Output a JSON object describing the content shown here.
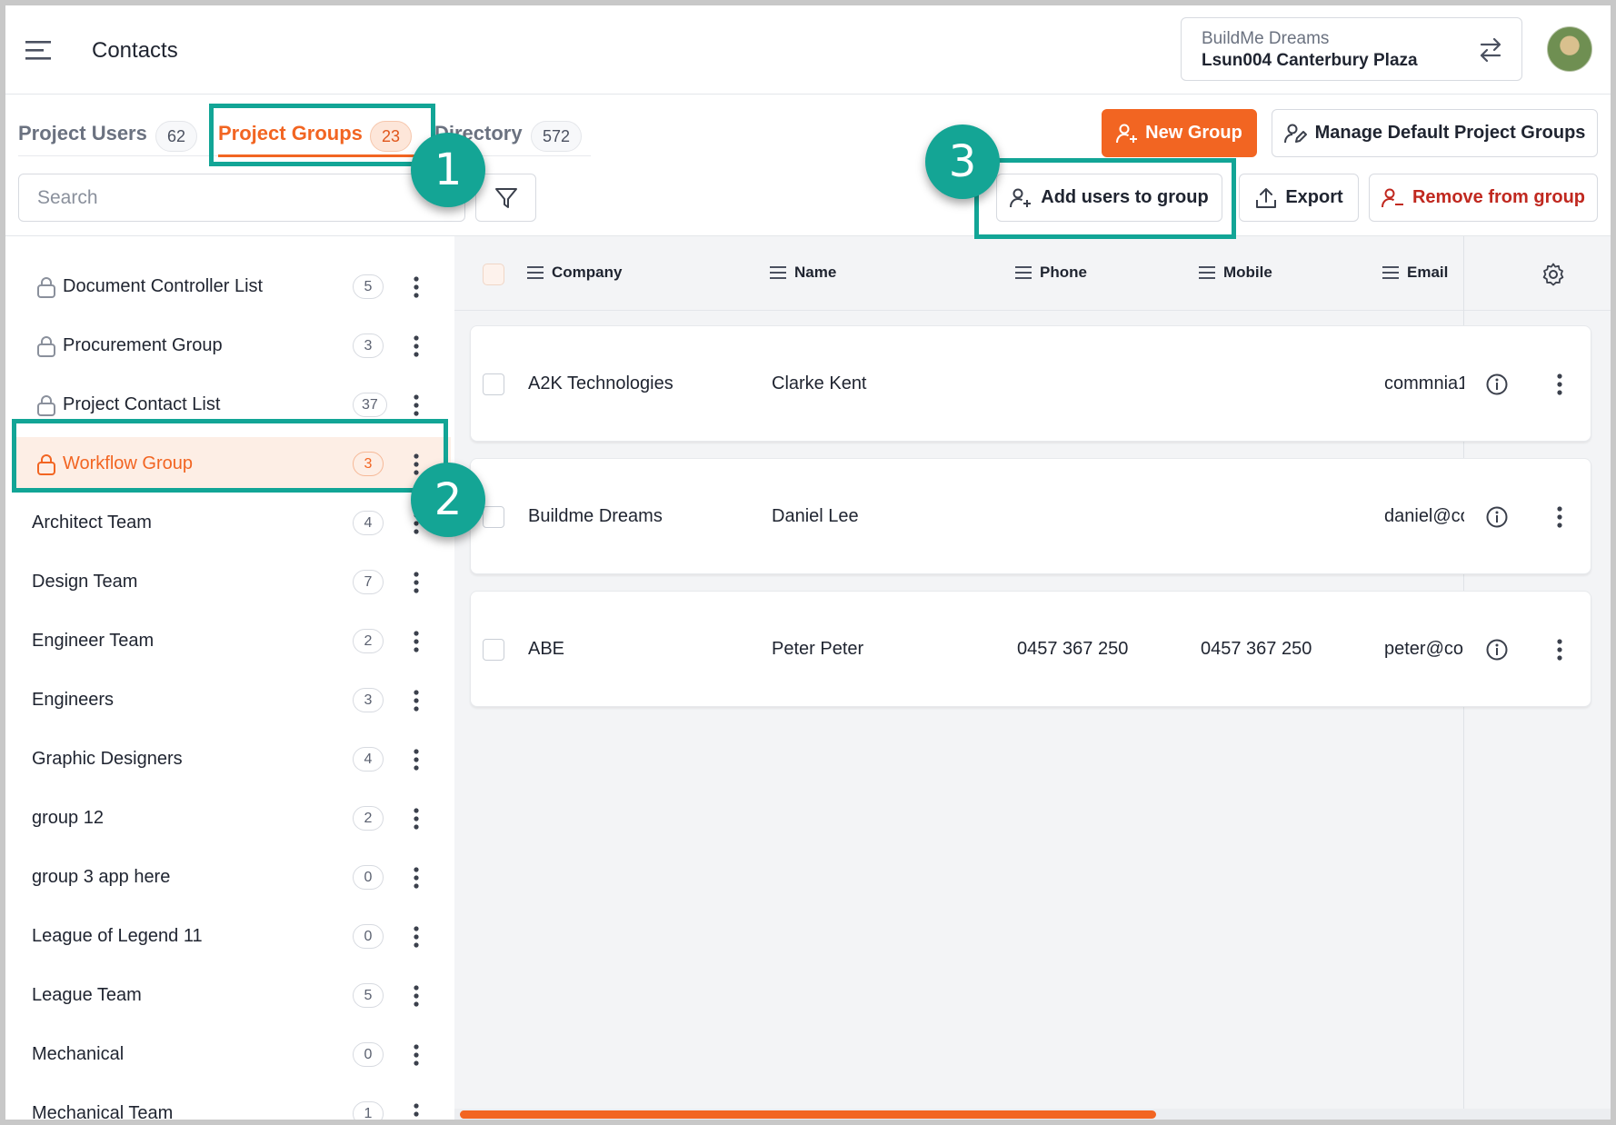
{
  "header": {
    "title": "Contacts",
    "project_switcher": {
      "company": "BuildMe Dreams",
      "project": "Lsun004 Canterbury Plaza"
    }
  },
  "tabs": [
    {
      "label": "Project Users",
      "count": "62"
    },
    {
      "label": "Project Groups",
      "count": "23",
      "active": true
    },
    {
      "label": "Directory",
      "count": "572"
    }
  ],
  "search": {
    "placeholder": "Search",
    "value": ""
  },
  "toolbar": {
    "new_group": "New Group",
    "manage_default": "Manage Default Project Groups",
    "add_users": "Add users to group",
    "export": "Export",
    "remove": "Remove from group"
  },
  "groups": [
    {
      "label": "Document Controller List",
      "count": "5",
      "locked": true
    },
    {
      "label": "Procurement Group",
      "count": "3",
      "locked": true
    },
    {
      "label": "Project Contact List",
      "count": "37",
      "locked": true
    },
    {
      "label": "Workflow Group",
      "count": "3",
      "locked": true,
      "selected": true
    },
    {
      "label": "Architect Team",
      "count": "4"
    },
    {
      "label": "Design Team",
      "count": "7"
    },
    {
      "label": "Engineer Team",
      "count": "2"
    },
    {
      "label": "Engineers",
      "count": "3"
    },
    {
      "label": "Graphic Designers",
      "count": "4"
    },
    {
      "label": "group 12",
      "count": "2"
    },
    {
      "label": "group 3 app here",
      "count": "0"
    },
    {
      "label": "League of Legend 11",
      "count": "0"
    },
    {
      "label": "League Team",
      "count": "5"
    },
    {
      "label": "Mechanical",
      "count": "0"
    },
    {
      "label": "Mechanical Team",
      "count": "1"
    }
  ],
  "table": {
    "columns": [
      "Company",
      "Name",
      "Phone",
      "Mobile",
      "Email"
    ],
    "rows": [
      {
        "company": "A2K Technologies",
        "name": "Clarke Kent",
        "phone": "",
        "mobile": "",
        "email": "commnia1"
      },
      {
        "company": "Buildme Dreams",
        "name": "Daniel Lee",
        "phone": "",
        "mobile": "",
        "email": "daniel@co"
      },
      {
        "company": "ABE",
        "name": "Peter Peter",
        "phone": "0457 367 250",
        "mobile": "0457 367 250",
        "email": "peter@co"
      }
    ]
  },
  "callouts": [
    "1",
    "2",
    "3"
  ],
  "colors": {
    "accent": "#f26522",
    "highlight": "#12a596",
    "danger": "#c0281f"
  },
  "icons": {
    "menu": "hamburger-icon",
    "swap": "swap-arrows-icon",
    "filter": "filter-icon",
    "lock": "lock-icon",
    "kebab": "kebab-menu-icon",
    "settings": "gear-icon",
    "info": "info-icon",
    "add_user": "add-user-icon",
    "manage": "user-edit-icon",
    "export": "upload-icon",
    "remove": "remove-user-icon"
  }
}
